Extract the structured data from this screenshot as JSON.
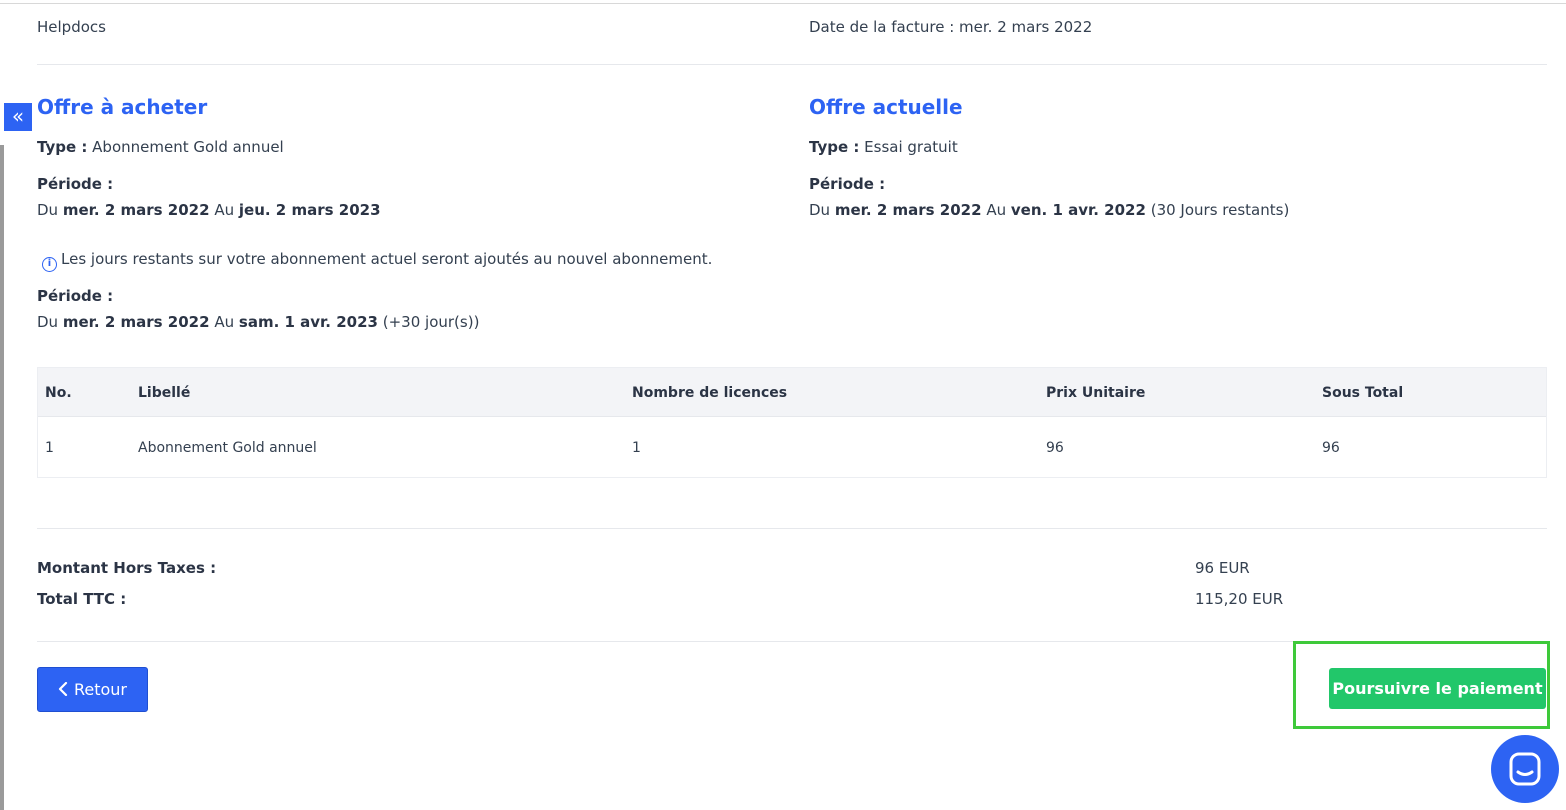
{
  "header": {
    "company_name": "Helpdocs",
    "invoice_date_label": "Date de la facture :",
    "invoice_date_value": "mer. 2 mars 2022"
  },
  "offer_to_buy": {
    "title": "Offre à acheter",
    "type_label": "Type :",
    "type_value": "Abonnement Gold annuel",
    "period_label": "Période :",
    "from_word": "Du",
    "from_date": "mer. 2 mars 2022",
    "to_word": "Au",
    "to_date": "jeu. 2 mars 2023"
  },
  "current_offer": {
    "title": "Offre actuelle",
    "type_label": "Type :",
    "type_value": "Essai gratuit",
    "period_label": "Période :",
    "from_word": "Du",
    "from_date": "mer. 2 mars 2022",
    "to_word": "Au",
    "to_date": "ven. 1 avr. 2022",
    "remaining": "(30 Jours restants)"
  },
  "notice": {
    "icon": "info-icon",
    "text": "Les jours restants sur votre abonnement actuel seront ajoutés au nouvel abonnement."
  },
  "new_period": {
    "period_label": "Période :",
    "from_word": "Du",
    "from_date": "mer. 2 mars 2022",
    "to_word": "Au",
    "to_date": "sam. 1 avr. 2023",
    "extra": "(+30 jour(s))"
  },
  "table": {
    "headers": [
      "No.",
      "Libellé",
      "Nombre de licences",
      "Prix Unitaire",
      "Sous Total"
    ],
    "rows": [
      [
        "1",
        "Abonnement Gold annuel",
        "1",
        "96",
        "96"
      ]
    ]
  },
  "totals": {
    "ht_label": "Montant Hors Taxes :",
    "ht_value": "96 EUR",
    "ttc_label": "Total TTC :",
    "ttc_value": "115,20 EUR"
  },
  "actions": {
    "back_label": "Retour",
    "pay_label": "Poursuivre le paiement"
  },
  "icons": {
    "collapse": "double-chevron-left-icon",
    "back": "chevron-left-icon",
    "chat": "chat-icon"
  },
  "colors": {
    "primary": "#2d63f3",
    "success": "#22c76a",
    "highlight": "#3ec93a"
  }
}
